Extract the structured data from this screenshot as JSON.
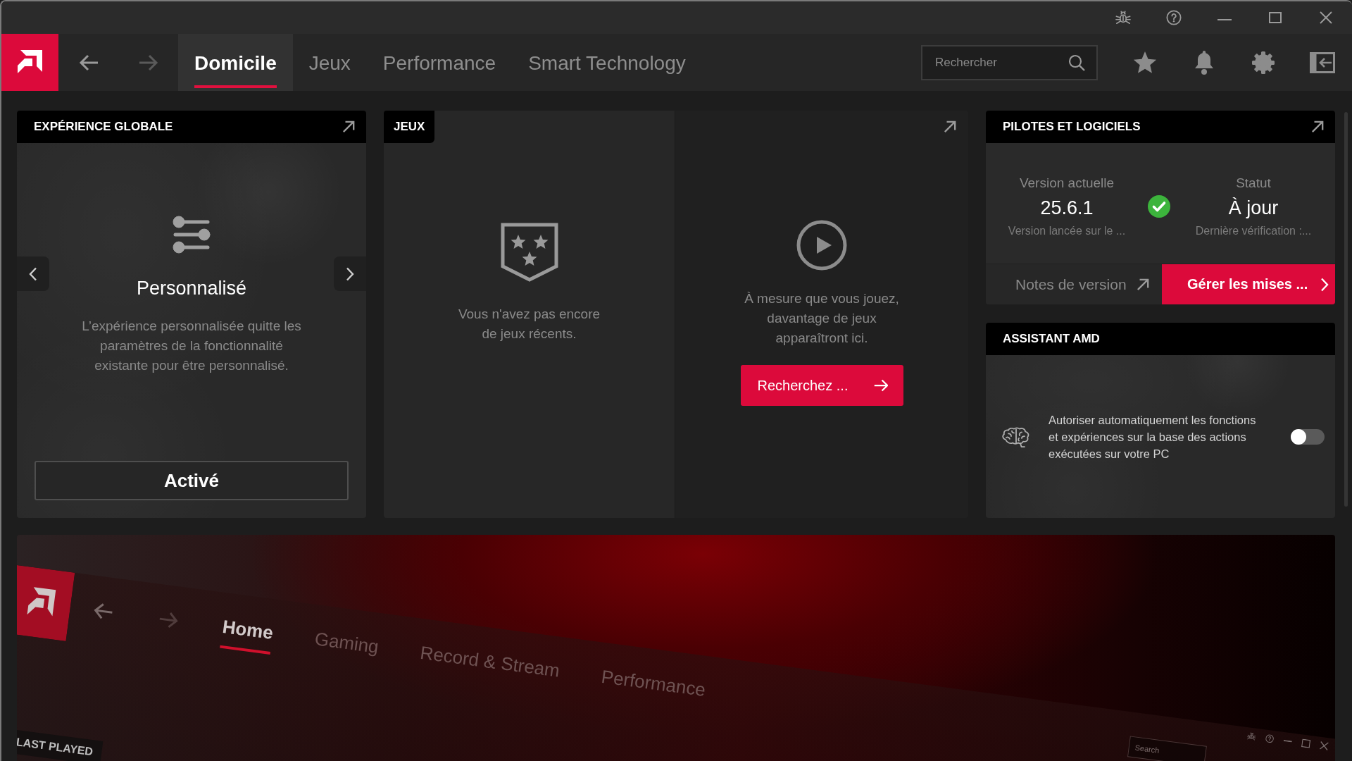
{
  "nav": {
    "back_disabled": false,
    "forward_disabled": true,
    "tabs": [
      {
        "label": "Domicile",
        "selected": true
      },
      {
        "label": "Jeux",
        "selected": false
      },
      {
        "label": "Performance",
        "selected": false
      },
      {
        "label": "Smart Technology",
        "selected": false
      }
    ],
    "search": {
      "placeholder": "Rechercher"
    }
  },
  "experience_card": {
    "title": "EXPÉRIENCE GLOBALE",
    "profile": "Personnalisé",
    "description": "L’expérience personnalisée quitte les paramètres de la fonctionnalité existante pour être personnalisé.",
    "button": "Activé"
  },
  "games_card": {
    "title": "JEUX",
    "empty_message": "Vous n'avez pas encore de jeux récents.",
    "hint": "À mesure que vous jouez, davantage de jeux apparaîtront ici.",
    "button": "Recherchez ..."
  },
  "drivers_card": {
    "title": "PILOTES ET LOGICIELS",
    "version_label": "Version actuelle",
    "version": "25.6.1",
    "release_note": "Version lancée sur le ...",
    "status_label": "Statut",
    "status": "À jour",
    "last_check": "Dernière vérification :...",
    "notes_button": "Notes de version",
    "manage_button": "Gérer les mises ..."
  },
  "assistant_card": {
    "title": "ASSISTANT AMD",
    "description": "Autoriser automatiquement les fonctions et expériences sur la base des actions exécutées sur votre PC",
    "on": false
  },
  "promo_banner": {
    "tabs": [
      {
        "label": "Home",
        "selected": true
      },
      {
        "label": "Gaming",
        "selected": false
      },
      {
        "label": "Record & Stream",
        "selected": false
      },
      {
        "label": "Performance",
        "selected": false
      }
    ],
    "search": {
      "placeholder": "Search"
    },
    "section_label": "LAST PLAYED"
  }
}
